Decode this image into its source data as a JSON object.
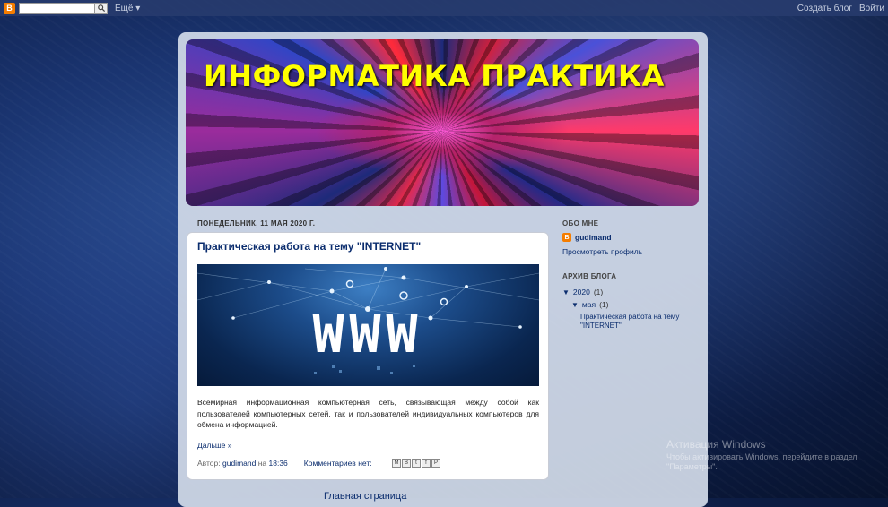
{
  "navbar": {
    "logo": "B",
    "search_value": "",
    "search_icon": "magnifier-icon",
    "more_label": "Ещё",
    "create_blog": "Создать блог",
    "login": "Войти"
  },
  "header": {
    "title": "ИНФОРМАТИКА ПРАКТИКА"
  },
  "post": {
    "date": "ПОНЕДЕЛЬНИК, 11 МАЯ 2020 Г.",
    "title": "Практическая работа на тему \"INTERNET\"",
    "image_text": "WWW",
    "body": "Всемирная информационная компьютерная сеть, связывающая между собой как пользователей компьютерных сетей, так и пользователей индивидуальных компьютеров для обмена информацией.",
    "read_more": "Дальше »",
    "author_prefix": "Автор:",
    "author": "gudimand",
    "time_prefix": "на",
    "time": "18:36",
    "comments": "Комментариев нет:",
    "share": [
      "M",
      "B",
      "t",
      "f",
      "P"
    ]
  },
  "home_link": "Главная страница",
  "sidebar": {
    "about_heading": "ОБО МНЕ",
    "profile_name": "gudimand",
    "view_profile": "Просмотреть профиль",
    "archive_heading": "АРХИВ БЛОГА",
    "archive": {
      "year": "2020",
      "year_count": "(1)",
      "month": "мая",
      "month_count": "(1)",
      "post_title": "Практическая работа на тему \"INTERNET\""
    }
  },
  "watermark": {
    "line1": "Активация Windows",
    "line2": "Чтобы активировать Windows, перейдите в раздел \"Параметры\"."
  },
  "colors": {
    "title_yellow": "#ffff00",
    "link_blue": "#0b2d6e",
    "blogger_orange": "#f57d00"
  }
}
